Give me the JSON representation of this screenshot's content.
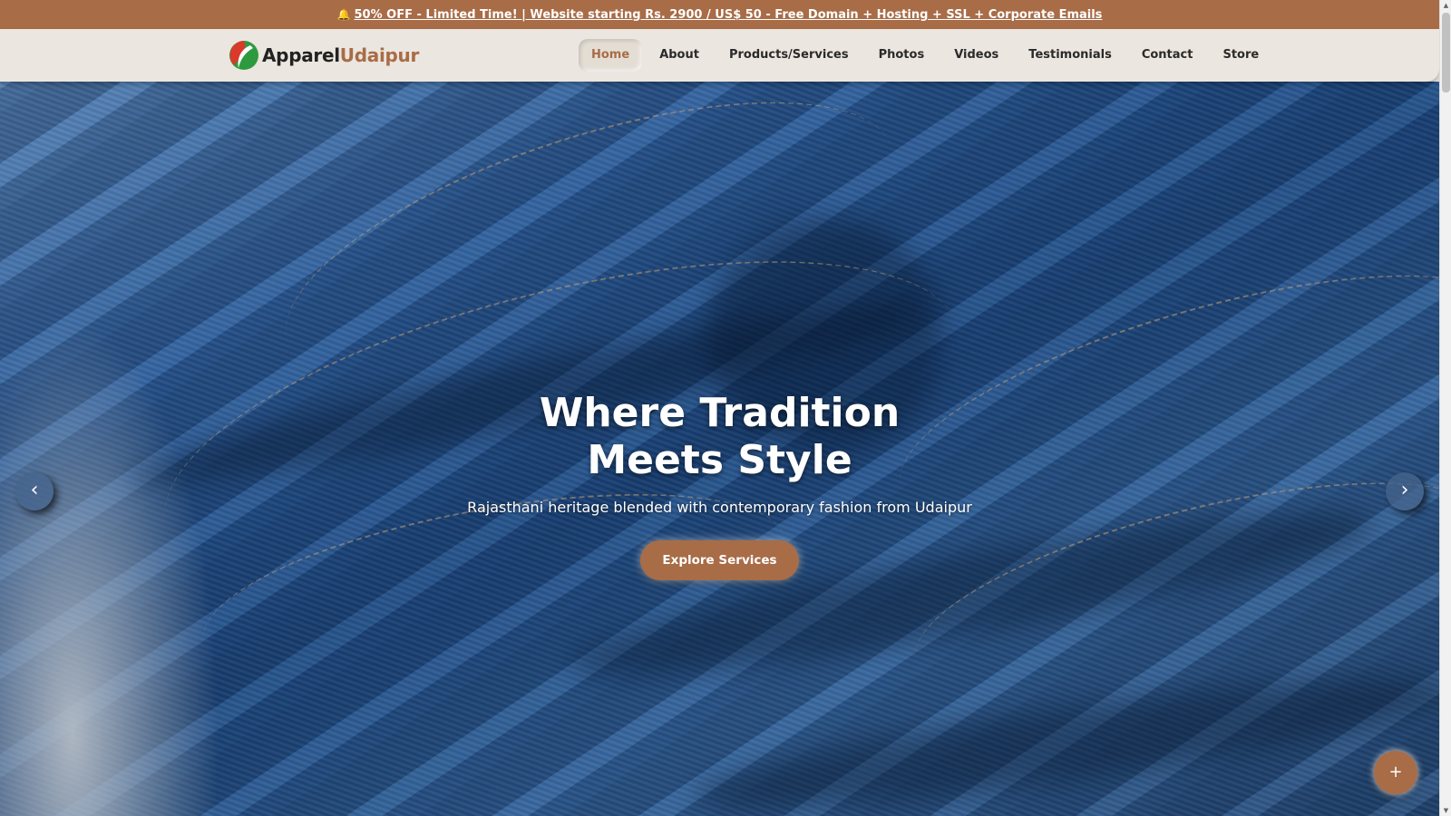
{
  "promo": {
    "bell_icon": "bell-icon",
    "text": "50% OFF - Limited Time! | Website starting Rs. 2900 / US$ 50 - Free Domain + Hosting + SSL + Corporate Emails"
  },
  "header": {
    "logo_part1": "Apparel",
    "logo_part2": "Udaipur",
    "nav": [
      {
        "label": "Home",
        "active": true
      },
      {
        "label": "About"
      },
      {
        "label": "Products/Services"
      },
      {
        "label": "Photos"
      },
      {
        "label": "Videos"
      },
      {
        "label": "Testimonials"
      },
      {
        "label": "Contact"
      },
      {
        "label": "Store"
      }
    ]
  },
  "hero": {
    "title": "Where Tradition Meets Style",
    "subtitle": "Rajasthani heritage blended with contemporary fashion from Udaipur",
    "cta": "Explore Services",
    "prev": "‹",
    "next": "›"
  },
  "fab": {
    "label": "+"
  },
  "colors": {
    "accent": "#a86c47",
    "nav_bg": "#ebe6df",
    "denim": "#2f64a8"
  }
}
